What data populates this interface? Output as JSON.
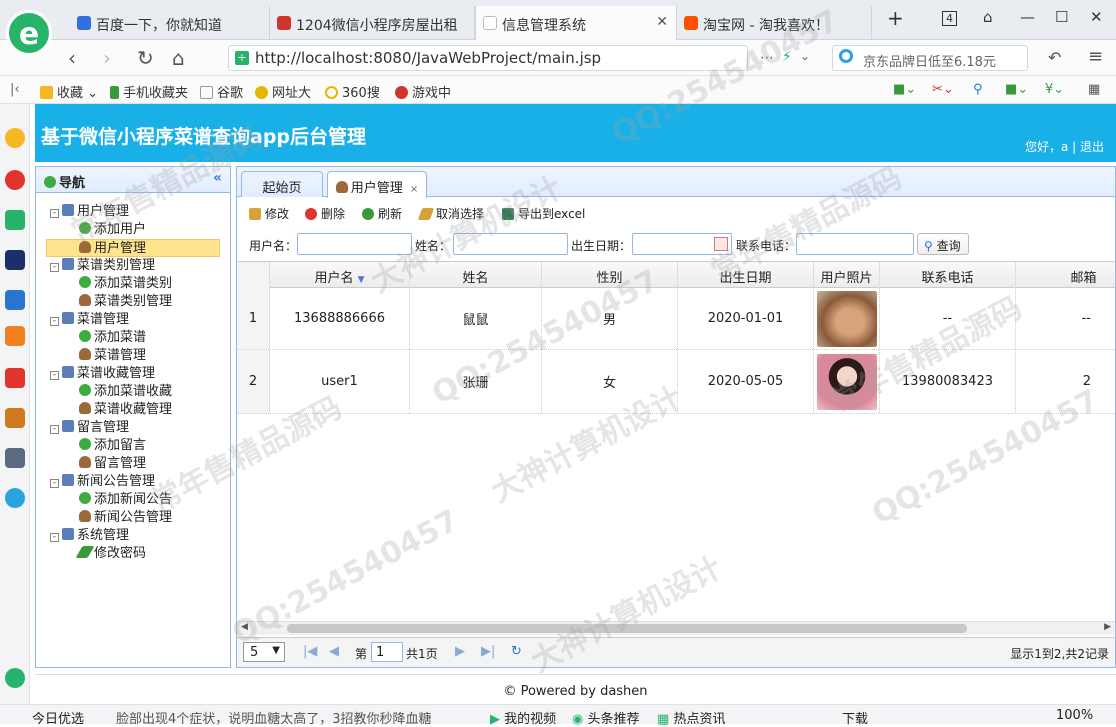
{
  "browser": {
    "tabs": [
      {
        "label": "百度一下，你就知道",
        "icon": "baidu-icon",
        "color": "#2f6fe0"
      },
      {
        "label": "1204微信小程序房屋出租",
        "icon": "site-icon",
        "color": "#d0342c"
      },
      {
        "label": "信息管理系统",
        "icon": "page-icon",
        "color": "#cfcfcf",
        "active": true
      },
      {
        "label": "淘宝网 - 淘我喜欢！",
        "icon": "taobao-icon",
        "color": "#ff5000"
      }
    ],
    "tab_count": "4",
    "url": "http://localhost:8080/JavaWebProject/main.jsp",
    "search_placeholder": "京东品牌日低至6.18元",
    "bookmarks": [
      "收藏",
      "手机收藏夹",
      "谷歌",
      "网址大",
      "360搜",
      "游戏中"
    ]
  },
  "app": {
    "title": "基于微信小程序菜谱查询app后台管理",
    "greeting": "您好，a",
    "logout": "退出"
  },
  "nav": {
    "title": "导航",
    "groups": [
      {
        "label": "用户管理",
        "items": [
          {
            "label": "添加用户",
            "type": "add"
          },
          {
            "label": "用户管理",
            "type": "user",
            "selected": true
          }
        ]
      },
      {
        "label": "菜谱类别管理",
        "items": [
          {
            "label": "添加菜谱类别",
            "type": "add"
          },
          {
            "label": "菜谱类别管理",
            "type": "user"
          }
        ]
      },
      {
        "label": "菜谱管理",
        "items": [
          {
            "label": "添加菜谱",
            "type": "add"
          },
          {
            "label": "菜谱管理",
            "type": "user"
          }
        ]
      },
      {
        "label": "菜谱收藏管理",
        "items": [
          {
            "label": "添加菜谱收藏",
            "type": "add"
          },
          {
            "label": "菜谱收藏管理",
            "type": "user"
          }
        ]
      },
      {
        "label": "留言管理",
        "items": [
          {
            "label": "添加留言",
            "type": "add"
          },
          {
            "label": "留言管理",
            "type": "user"
          }
        ]
      },
      {
        "label": "新闻公告管理",
        "items": [
          {
            "label": "添加新闻公告",
            "type": "add"
          },
          {
            "label": "新闻公告管理",
            "type": "user"
          }
        ]
      },
      {
        "label": "系统管理",
        "items": [
          {
            "label": "修改密码",
            "type": "pen"
          }
        ]
      }
    ]
  },
  "main": {
    "tabs": [
      {
        "label": "起始页"
      },
      {
        "label": "用户管理",
        "active": true
      }
    ],
    "toolbar": {
      "edit": "修改",
      "delete": "删除",
      "refresh": "刷新",
      "unselect": "取消选择",
      "export": "导出到excel"
    },
    "filter": {
      "username_label": "用户名：",
      "name_label": "姓名：",
      "birth_label": "出生日期：",
      "phone_label": "联系电话：",
      "query": "查询"
    },
    "grid": {
      "columns": [
        "用户名",
        "姓名",
        "性别",
        "出生日期",
        "用户照片",
        "联系电话",
        "邮箱"
      ],
      "rows": [
        {
          "no": "1",
          "username": "13688886666",
          "name": "鼠鼠",
          "gender": "男",
          "birth": "2020-01-01",
          "phone": "--",
          "email": "--"
        },
        {
          "no": "2",
          "username": "user1",
          "name": "张珊",
          "gender": "女",
          "birth": "2020-05-05",
          "phone": "13980083423",
          "email": "2"
        }
      ]
    },
    "pager": {
      "page_size": "5",
      "page_prefix": "第",
      "page_value": "1",
      "page_total": "共1页",
      "summary": "显示1到2,共2记录"
    }
  },
  "footer": "© Powered by dashen",
  "status_bar": [
    "今日优选",
    "脸部出现4个症状，说明血糖太高了，3招教你秒降血糖",
    "我的视频",
    "头条推荐",
    "热点资讯",
    "下载",
    "100%"
  ],
  "watermarks": [
    "QQ:254540457",
    "常年售精品源码",
    "大神计算机设计"
  ]
}
